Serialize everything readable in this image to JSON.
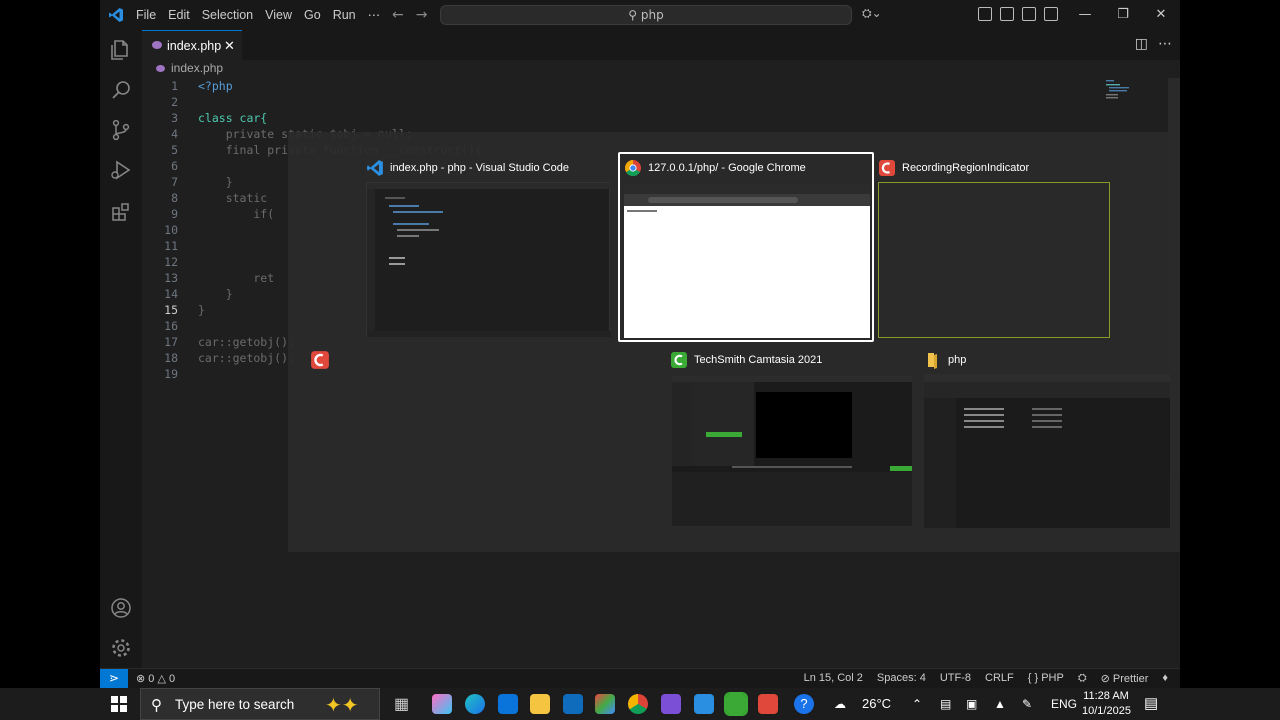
{
  "menu": [
    "File",
    "Edit",
    "Selection",
    "View",
    "Go",
    "Run",
    "⋯"
  ],
  "command_center": {
    "text": "php"
  },
  "tab": {
    "label": "index.php",
    "close": "✕"
  },
  "breadcrumb": "index.php",
  "editor": {
    "active_line": 15,
    "lines": [
      {
        "n": "1",
        "text": "<?php"
      },
      {
        "n": "2",
        "text": ""
      },
      {
        "n": "3",
        "text": "class car{"
      },
      {
        "n": "4",
        "text": "    private static $obj = null;"
      },
      {
        "n": "5",
        "text": "    final private function __construct(){"
      },
      {
        "n": "6",
        "text": ""
      },
      {
        "n": "7",
        "text": "    }"
      },
      {
        "n": "8",
        "text": "    static"
      },
      {
        "n": "9",
        "text": "        if("
      },
      {
        "n": "10",
        "text": ""
      },
      {
        "n": "11",
        "text": ""
      },
      {
        "n": "12",
        "text": ""
      },
      {
        "n": "13",
        "text": "        ret"
      },
      {
        "n": "14",
        "text": "    }"
      },
      {
        "n": "15",
        "text": "}"
      },
      {
        "n": "16",
        "text": ""
      },
      {
        "n": "17",
        "text": "car::getobj();"
      },
      {
        "n": "18",
        "text": "car::getobj();"
      },
      {
        "n": "19",
        "text": ""
      }
    ]
  },
  "status": {
    "errors": "0",
    "warnings": "0",
    "position": "Ln 15, Col 2",
    "spaces": "Spaces: 4",
    "encoding": "UTF-8",
    "eol": "CRLF",
    "language": "{ } PHP",
    "formatter": "Prettier"
  },
  "switcher": {
    "windows": [
      {
        "title": "index.php - php - Visual Studio Code",
        "icon": "vscode-icon"
      },
      {
        "title": "127.0.0.1/php/ - Google Chrome",
        "icon": "chrome-icon",
        "selected": true
      },
      {
        "title": "RecordingRegionIndicator",
        "icon": "camtasia-recorder-icon"
      },
      {
        "title": "TechSmith Camtasia 2021",
        "icon": "camtasia-icon"
      },
      {
        "title": "php",
        "icon": "folder-icon"
      }
    ]
  },
  "taskbar": {
    "search_placeholder": "Type here to search",
    "weather": "26°C",
    "language": "ENG",
    "time": "11:28 AM",
    "date": "10/1/2025"
  },
  "colors": {
    "accent": "#0078d4",
    "editor_bg": "#1f1f1f",
    "switcher_select": "#ffffff"
  }
}
